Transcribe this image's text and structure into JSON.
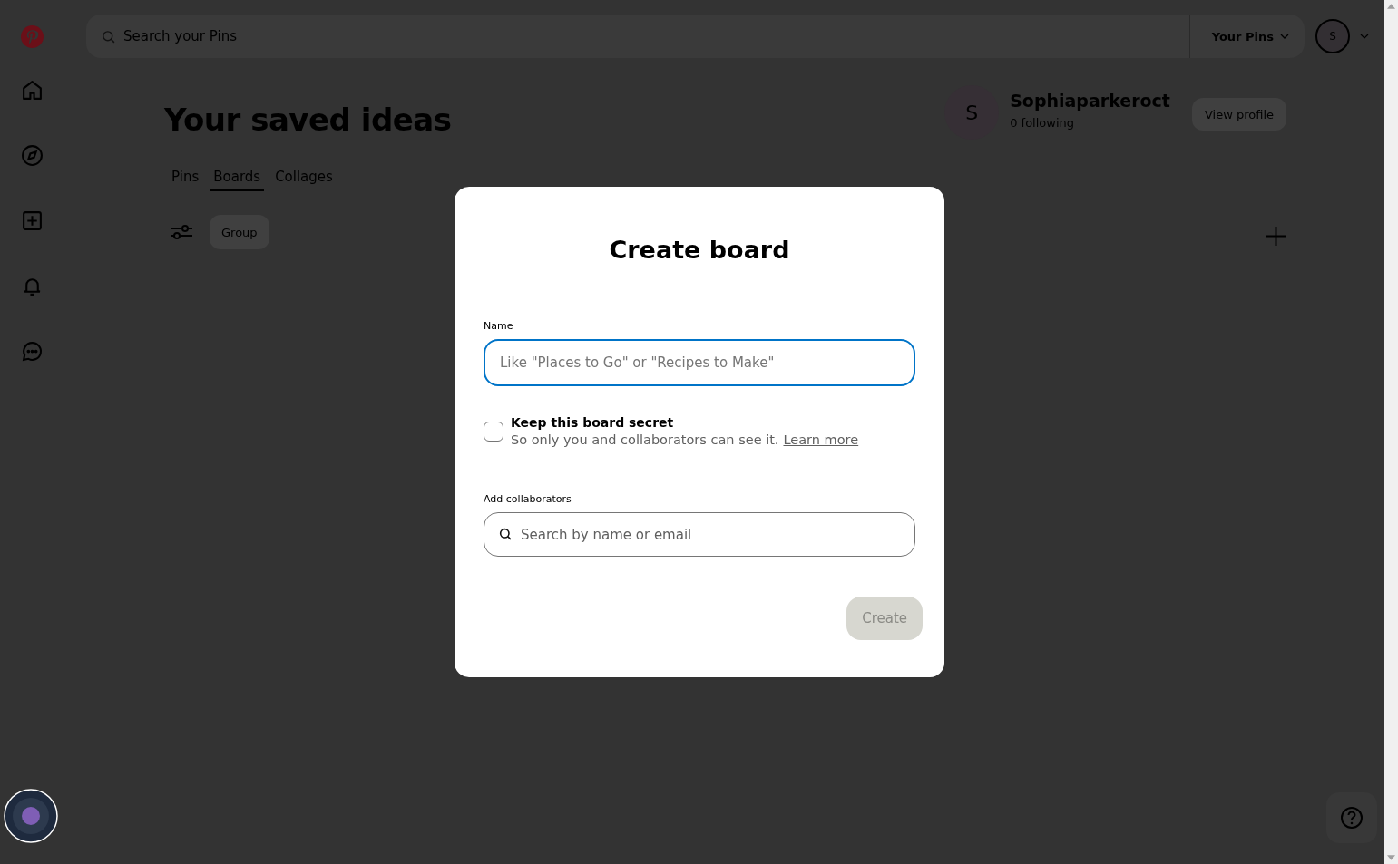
{
  "top_bar": {
    "search": {
      "placeholder": "Search your Pins"
    },
    "filter": "Your Pins",
    "avatar": "S"
  },
  "page": {
    "title": "Your saved ideas",
    "tabs": [
      {
        "label": "Pins",
        "selected": false
      },
      {
        "label": "Boards",
        "selected": true
      },
      {
        "label": "Collages",
        "selected": false
      }
    ],
    "group_button": "Group"
  },
  "profile": {
    "avatar": "S",
    "name": "Sophiaparkeroct",
    "following": "0 following",
    "button": "View profile"
  },
  "dialog": {
    "title": "Create board",
    "name_label": "Name",
    "name_field": {
      "placeholder": "Like \"Places to Go\" or \"Recipes to Make\""
    },
    "secret": {
      "label": "Keep this board secret",
      "description": "So only you and collaborators can see it.",
      "link": "Learn more",
      "checked": false
    },
    "collaborators_label": "Add collaborators",
    "collaborators_field": {
      "placeholder": "Search by name or email"
    },
    "create_button": {
      "label": "Create",
      "disabled": true
    }
  }
}
